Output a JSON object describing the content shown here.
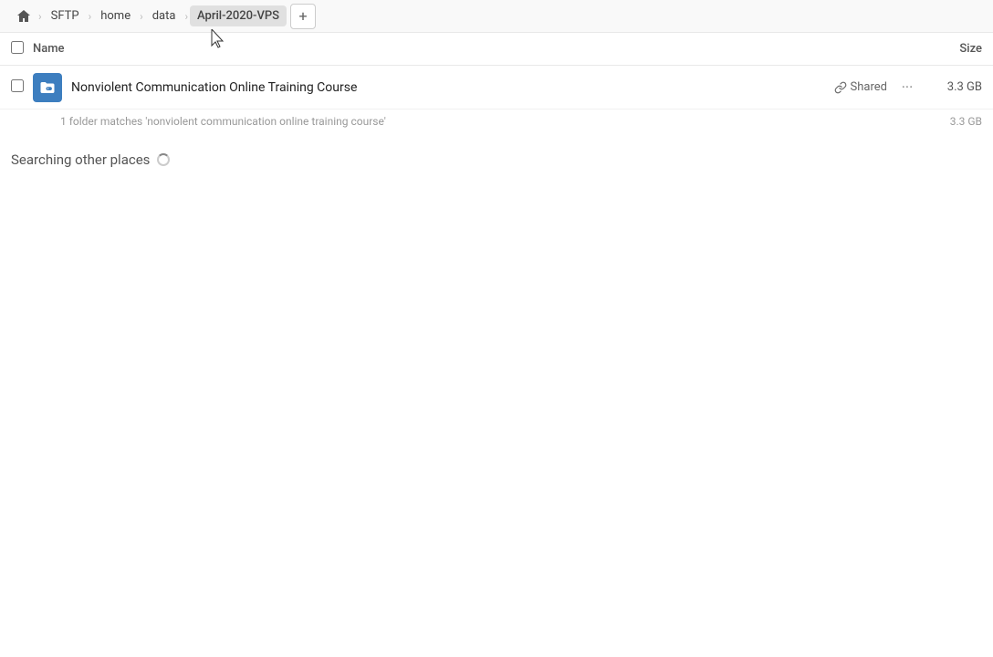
{
  "nav": {
    "home_label": "SFTP",
    "breadcrumbs": [
      "home",
      "data",
      "April-2020-VPS"
    ],
    "add_tab_label": "+"
  },
  "columns": {
    "name_label": "Name",
    "size_label": "Size"
  },
  "file": {
    "name": "Nonviolent Communication Online Training Course",
    "shared_label": "Shared",
    "size": "3.3 GB",
    "more_icon": "···"
  },
  "summary": {
    "text": "1 folder matches 'nonviolent communication online training course'",
    "size": "3.3 GB"
  },
  "searching": {
    "label": "Searching other places"
  }
}
